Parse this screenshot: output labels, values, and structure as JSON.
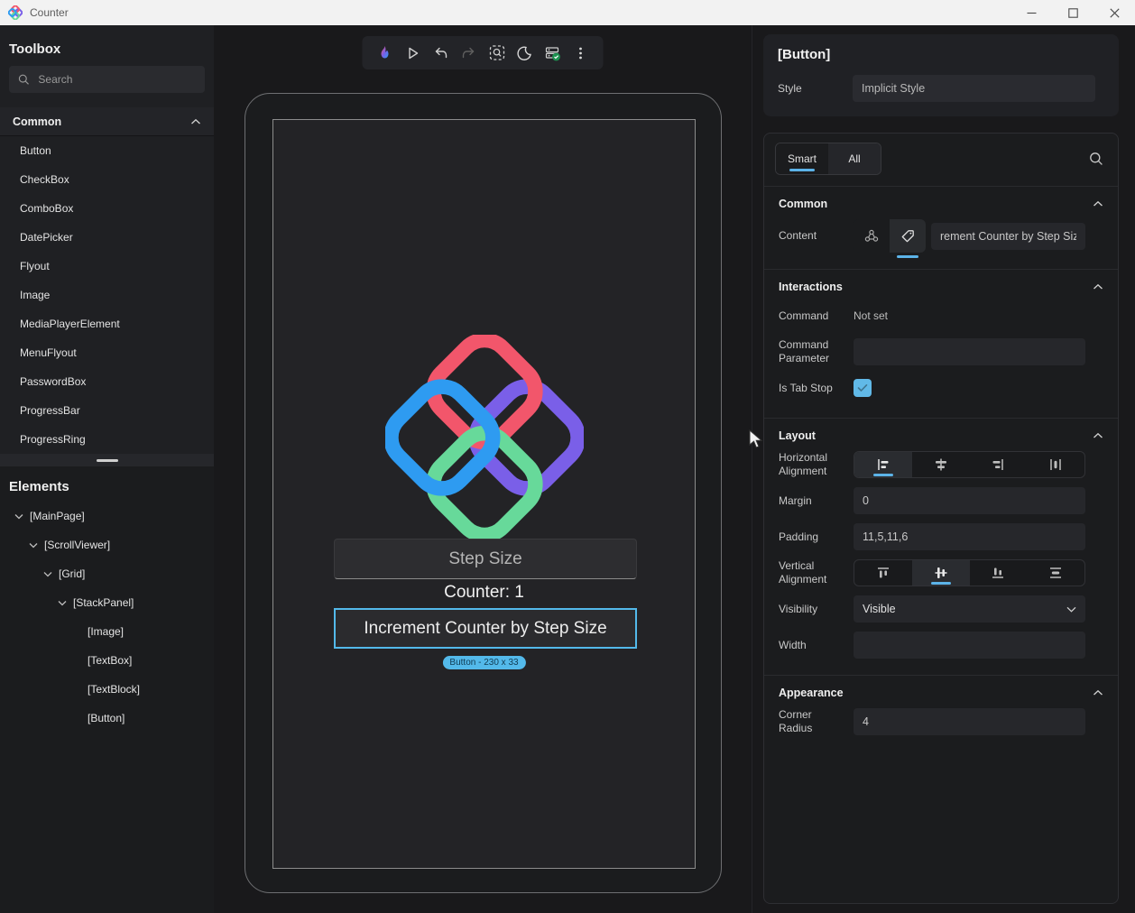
{
  "window": {
    "title": "Counter",
    "controls": [
      "minimize",
      "maximize",
      "close"
    ]
  },
  "toolbox": {
    "title": "Toolbox",
    "search_placeholder": "Search",
    "group_label": "Common",
    "items": [
      "Button",
      "CheckBox",
      "ComboBox",
      "DatePicker",
      "Flyout",
      "Image",
      "MediaPlayerElement",
      "MenuFlyout",
      "PasswordBox",
      "ProgressBar",
      "ProgressRing"
    ]
  },
  "elements": {
    "title": "Elements",
    "tree": [
      {
        "label": "[MainPage]",
        "depth": 0,
        "expanded": true
      },
      {
        "label": "[ScrollViewer]",
        "depth": 1,
        "expanded": true
      },
      {
        "label": "[Grid]",
        "depth": 2,
        "expanded": true
      },
      {
        "label": "[StackPanel]",
        "depth": 3,
        "expanded": true
      },
      {
        "label": "[Image]",
        "depth": 4,
        "expanded": false
      },
      {
        "label": "[TextBox]",
        "depth": 4,
        "expanded": false
      },
      {
        "label": "[TextBlock]",
        "depth": 4,
        "expanded": false
      },
      {
        "label": "[Button]",
        "depth": 4,
        "expanded": false
      }
    ]
  },
  "toolbar": {
    "icons": [
      "hot-reload-flame",
      "play",
      "undo",
      "redo",
      "zoom-selection",
      "dark-theme-moon",
      "devserver-status-ok",
      "more-options"
    ]
  },
  "preview": {
    "textbox_placeholder": "Step Size",
    "counter_text": "Counter: 1",
    "button_label": "Increment Counter by Step Size",
    "size_badge": "Button - 230 x 33"
  },
  "inspector": {
    "header": {
      "title": "[Button]",
      "style_label": "Style",
      "style_value": "Implicit Style"
    },
    "tabs": {
      "smart": "Smart",
      "all": "All",
      "selected": "Smart"
    },
    "sections": {
      "common": {
        "title": "Common",
        "content_label": "Content",
        "content_mode_icons": [
          "binding-icon",
          "tag-icon"
        ],
        "content_mode_selected": "tag-icon",
        "content_value": "rement Counter by Step Size"
      },
      "interactions": {
        "title": "Interactions",
        "command_label": "Command",
        "command_value": "Not set",
        "command_parameter_label": "Command Parameter",
        "command_parameter_value": "",
        "is_tab_stop_label": "Is Tab Stop",
        "is_tab_stop_checked": true
      },
      "layout": {
        "title": "Layout",
        "horizontal_alignment_label": "Horizontal Alignment",
        "horizontal_options": [
          "left",
          "center",
          "right",
          "stretch"
        ],
        "horizontal_selected": "left",
        "margin_label": "Margin",
        "margin_value": "0",
        "padding_label": "Padding",
        "padding_value": "11,5,11,6",
        "vertical_alignment_label": "Vertical Alignment",
        "vertical_options": [
          "top",
          "center",
          "bottom",
          "stretch"
        ],
        "vertical_selected": "center",
        "visibility_label": "Visibility",
        "visibility_value": "Visible",
        "width_label": "Width",
        "width_value": ""
      },
      "appearance": {
        "title": "Appearance",
        "corner_radius_label": "Corner Radius",
        "corner_radius_value": "4"
      }
    }
  },
  "colors": {
    "accent": "#5CB3E8",
    "selection_border": "#53B9EA",
    "badge_bg": "#53B9EA",
    "checkbox_bg": "#61B9E8",
    "status_green": "#1E9150",
    "logo_red": "#F2566B",
    "logo_blue": "#2E9BF1",
    "logo_purple": "#7A5FE8",
    "logo_green": "#67D99A"
  }
}
